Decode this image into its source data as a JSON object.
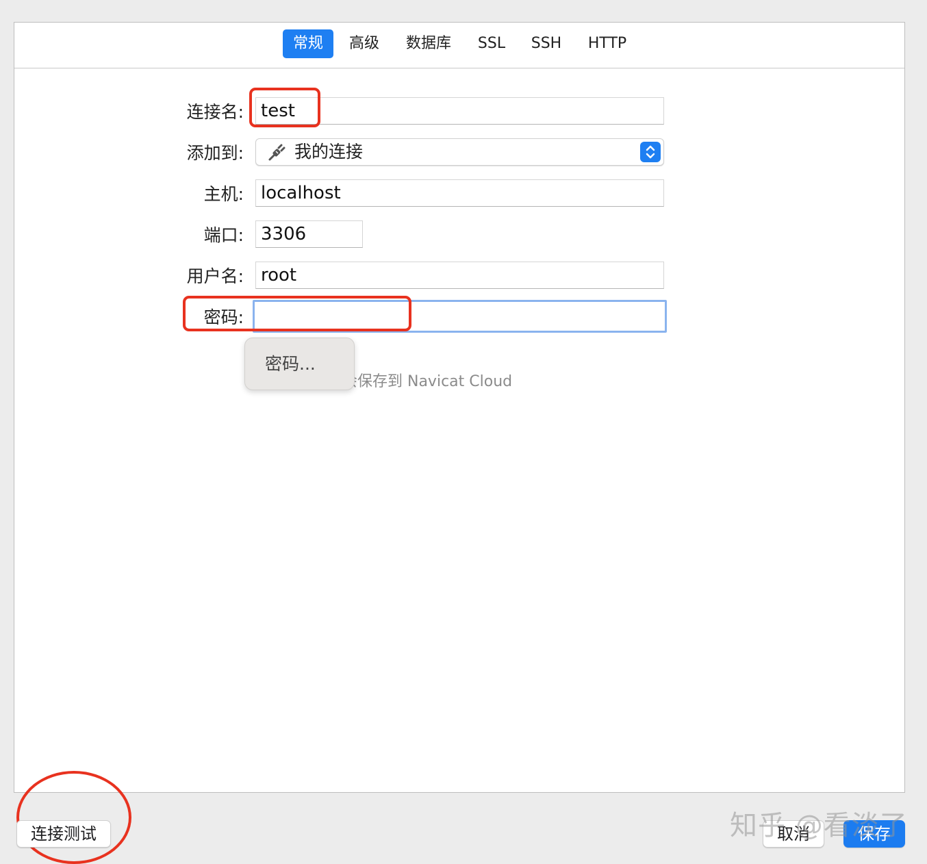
{
  "tabs": [
    {
      "label": "常规"
    },
    {
      "label": "高级"
    },
    {
      "label": "数据库"
    },
    {
      "label": "SSL"
    },
    {
      "label": "SSH"
    },
    {
      "label": "HTTP"
    }
  ],
  "active_tab": "常规",
  "form": {
    "connection_name_label": "连接名:",
    "connection_name_value": "test",
    "add_to_label": "添加到:",
    "add_to_value": "我的连接",
    "host_label": "主机:",
    "host_value": "localhost",
    "port_label": "端口:",
    "port_value": "3306",
    "username_label": "用户名:",
    "username_value": "root",
    "password_label": "密码:",
    "password_value": ""
  },
  "password_popup": {
    "label": "密码..."
  },
  "save_to_cloud_text": "会保存到 Navicat Cloud",
  "buttons": {
    "test_connection": "连接测试",
    "cancel": "取消",
    "save": "保存"
  },
  "watermark": "知乎 @看淡了",
  "colors": {
    "accent": "#1e7ff2",
    "annotation_red": "#e8321f",
    "focus_ring": "#8ab3ee"
  },
  "icons": {
    "add_to_icon": "plug-icon",
    "select_stepper": "up-down-chevron-icon"
  }
}
